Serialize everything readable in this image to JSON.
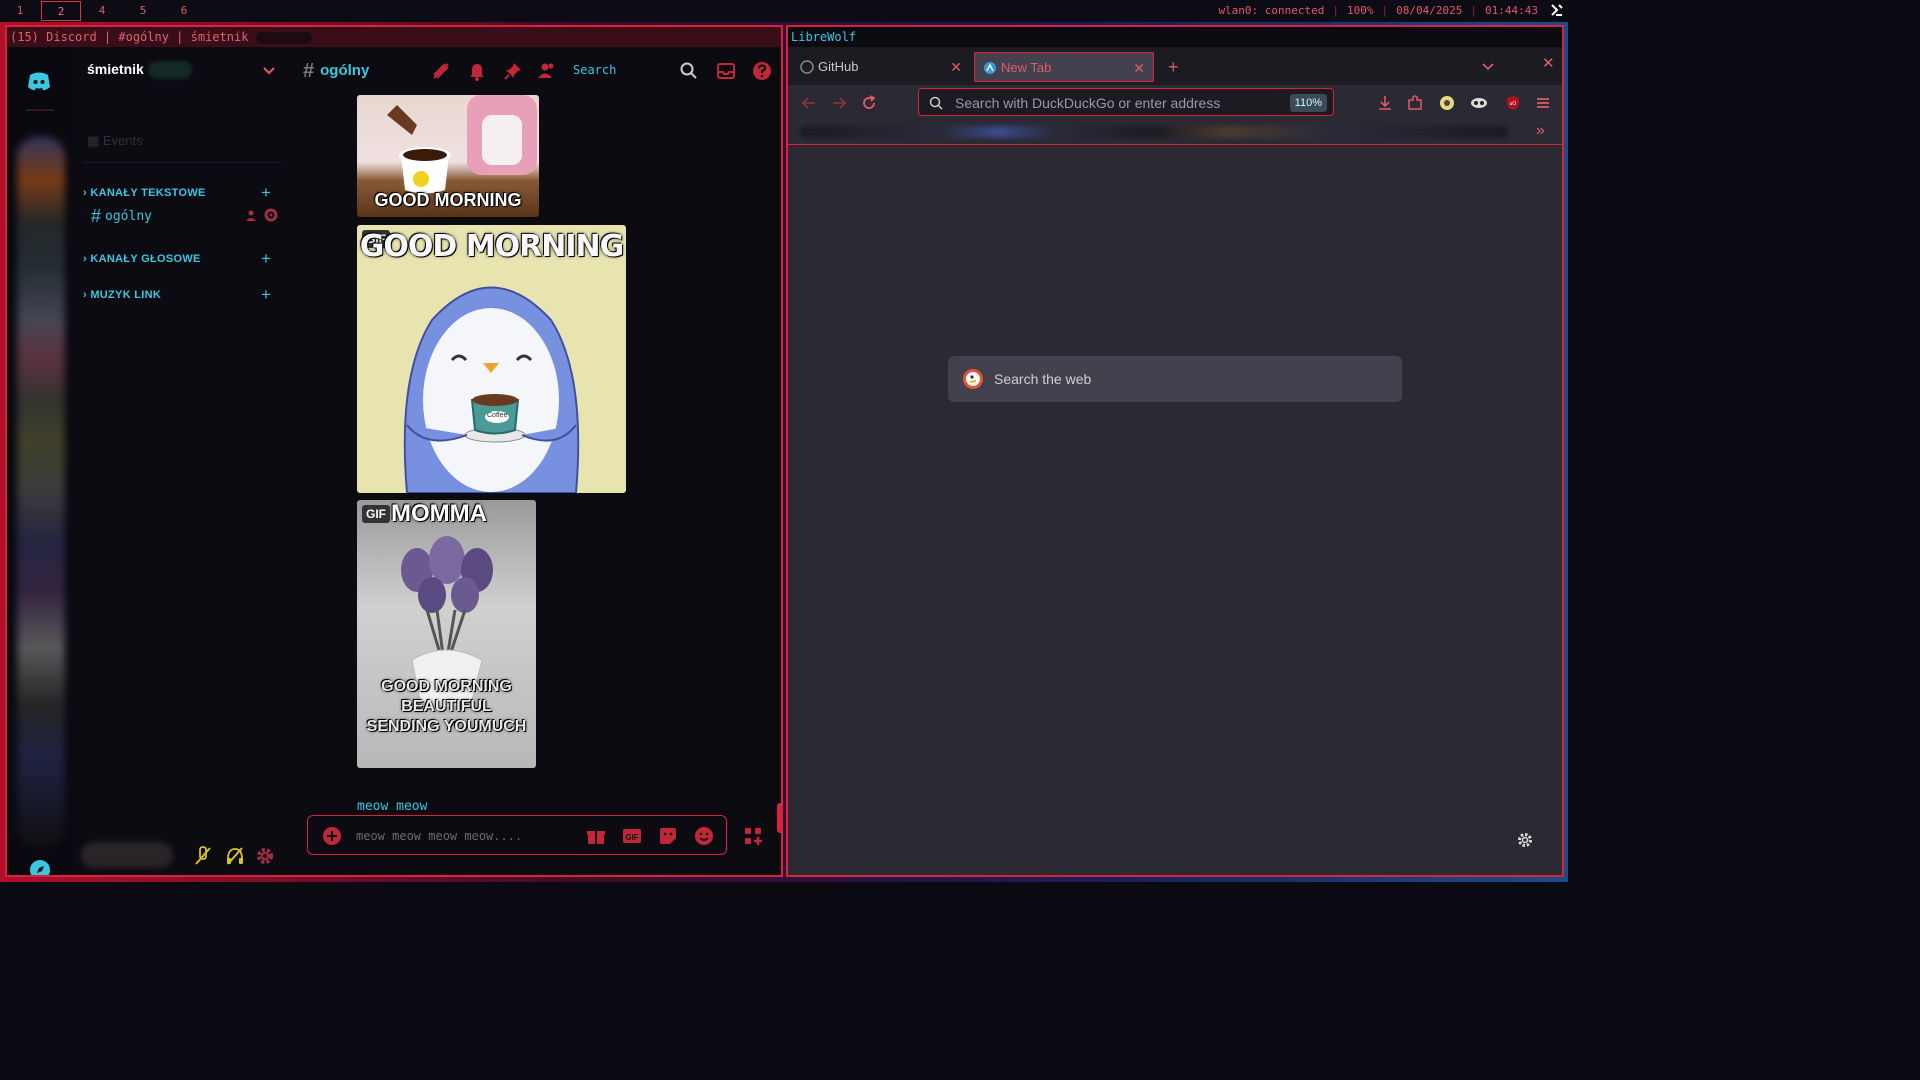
{
  "topbar": {
    "workspaces": [
      "1",
      "2",
      "4",
      "5",
      "6"
    ],
    "active_workspace": "2",
    "wifi": "wlan0: connected",
    "volume": "100%",
    "date": "08/04/2025",
    "time": "01:44:43"
  },
  "discord": {
    "window_title": "(15) Discord | #ogólny | śmietnik",
    "server_name": "śmietnik",
    "events_label": "Events",
    "categories": [
      {
        "label": "KANAŁY TEKSTOWE"
      },
      {
        "label": "KANAŁY GŁOSOWE"
      },
      {
        "label": "MUZYK LINK"
      }
    ],
    "active_channel": "ogólny",
    "header": {
      "channel": "ogólny",
      "search_label": "Search"
    },
    "messages": {
      "gif1_caption": "GOOD MORNING",
      "gif2_badge": "GIF",
      "gif2_caption": "GOOD MORNING",
      "gif2_cup_label": "Coffee",
      "gif3_badge": "GIF",
      "gif3_title": "MOMMA",
      "gif3_caption": "GOOD MORNING BEAUTIFUL SENDING YOUMUCH",
      "text": "meow meow"
    },
    "composer_placeholder": "meow meow meow meow...."
  },
  "browser": {
    "window_title": "LibreWolf",
    "tabs": [
      {
        "label": "GitHub",
        "active": false
      },
      {
        "label": "New Tab",
        "active": true
      }
    ],
    "url_placeholder": "Search with DuckDuckGo or enter address",
    "zoom": "110%",
    "web_search_placeholder": "Search the web"
  },
  "colors": {
    "accent": "#d8243a",
    "cyan": "#3ac8e0",
    "bg": "#0c0b12"
  }
}
